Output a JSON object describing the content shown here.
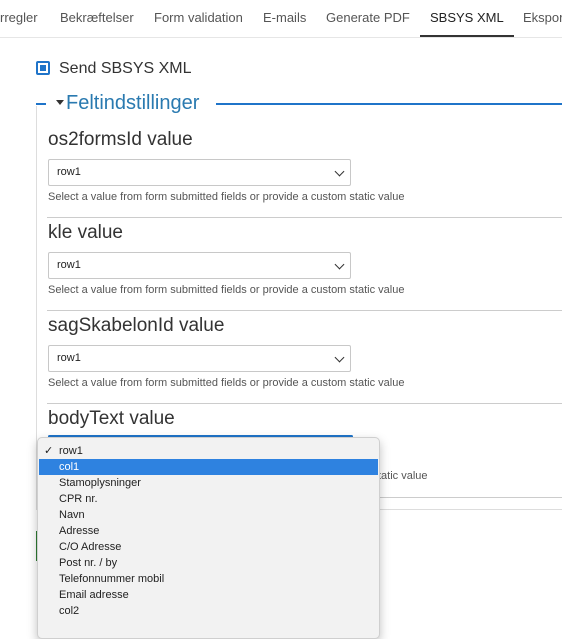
{
  "tabs": [
    {
      "label": "rregler"
    },
    {
      "label": "Bekræftelser"
    },
    {
      "label": "Form validation"
    },
    {
      "label": "E-mails"
    },
    {
      "label": "Generate PDF"
    },
    {
      "label": "SBSYS XML"
    },
    {
      "label": "Ekspor"
    }
  ],
  "send_checkbox": {
    "label": "Send SBSYS XML",
    "checked": true
  },
  "fieldset": {
    "legend": "Feltindstillinger"
  },
  "fields": [
    {
      "title": "os2formsId value",
      "selected": "row1",
      "description": "Select a value from form submitted fields or provide a custom static value"
    },
    {
      "title": "kle value",
      "selected": "row1",
      "description": "Select a value from form submitted fields or provide a custom static value"
    },
    {
      "title": "sagSkabelonId value",
      "selected": "row1",
      "description": "Select a value from form submitted fields or provide a custom static value"
    },
    {
      "title": "bodyText value",
      "selected": "row1",
      "description": "Select a value from form submitted fields or provide a custom static value",
      "description_visible_tail": "tatic value"
    }
  ],
  "dropdown": {
    "checkmark": "✓",
    "options": [
      {
        "label": "row1",
        "checked": true
      },
      {
        "label": "col1",
        "highlighted": true
      },
      {
        "label": "Stamoplysninger"
      },
      {
        "label": "CPR nr."
      },
      {
        "label": "Navn"
      },
      {
        "label": "Adresse"
      },
      {
        "label": "C/O Adresse"
      },
      {
        "label": "Post nr. / by"
      },
      {
        "label": "Telefonnummer mobil"
      },
      {
        "label": "Email adresse"
      },
      {
        "label": "col2"
      }
    ]
  },
  "colors": {
    "accent": "#1f74c9",
    "legend_text": "#2a7ab0",
    "highlight": "#2e82e0",
    "success": "#2e7d32"
  }
}
